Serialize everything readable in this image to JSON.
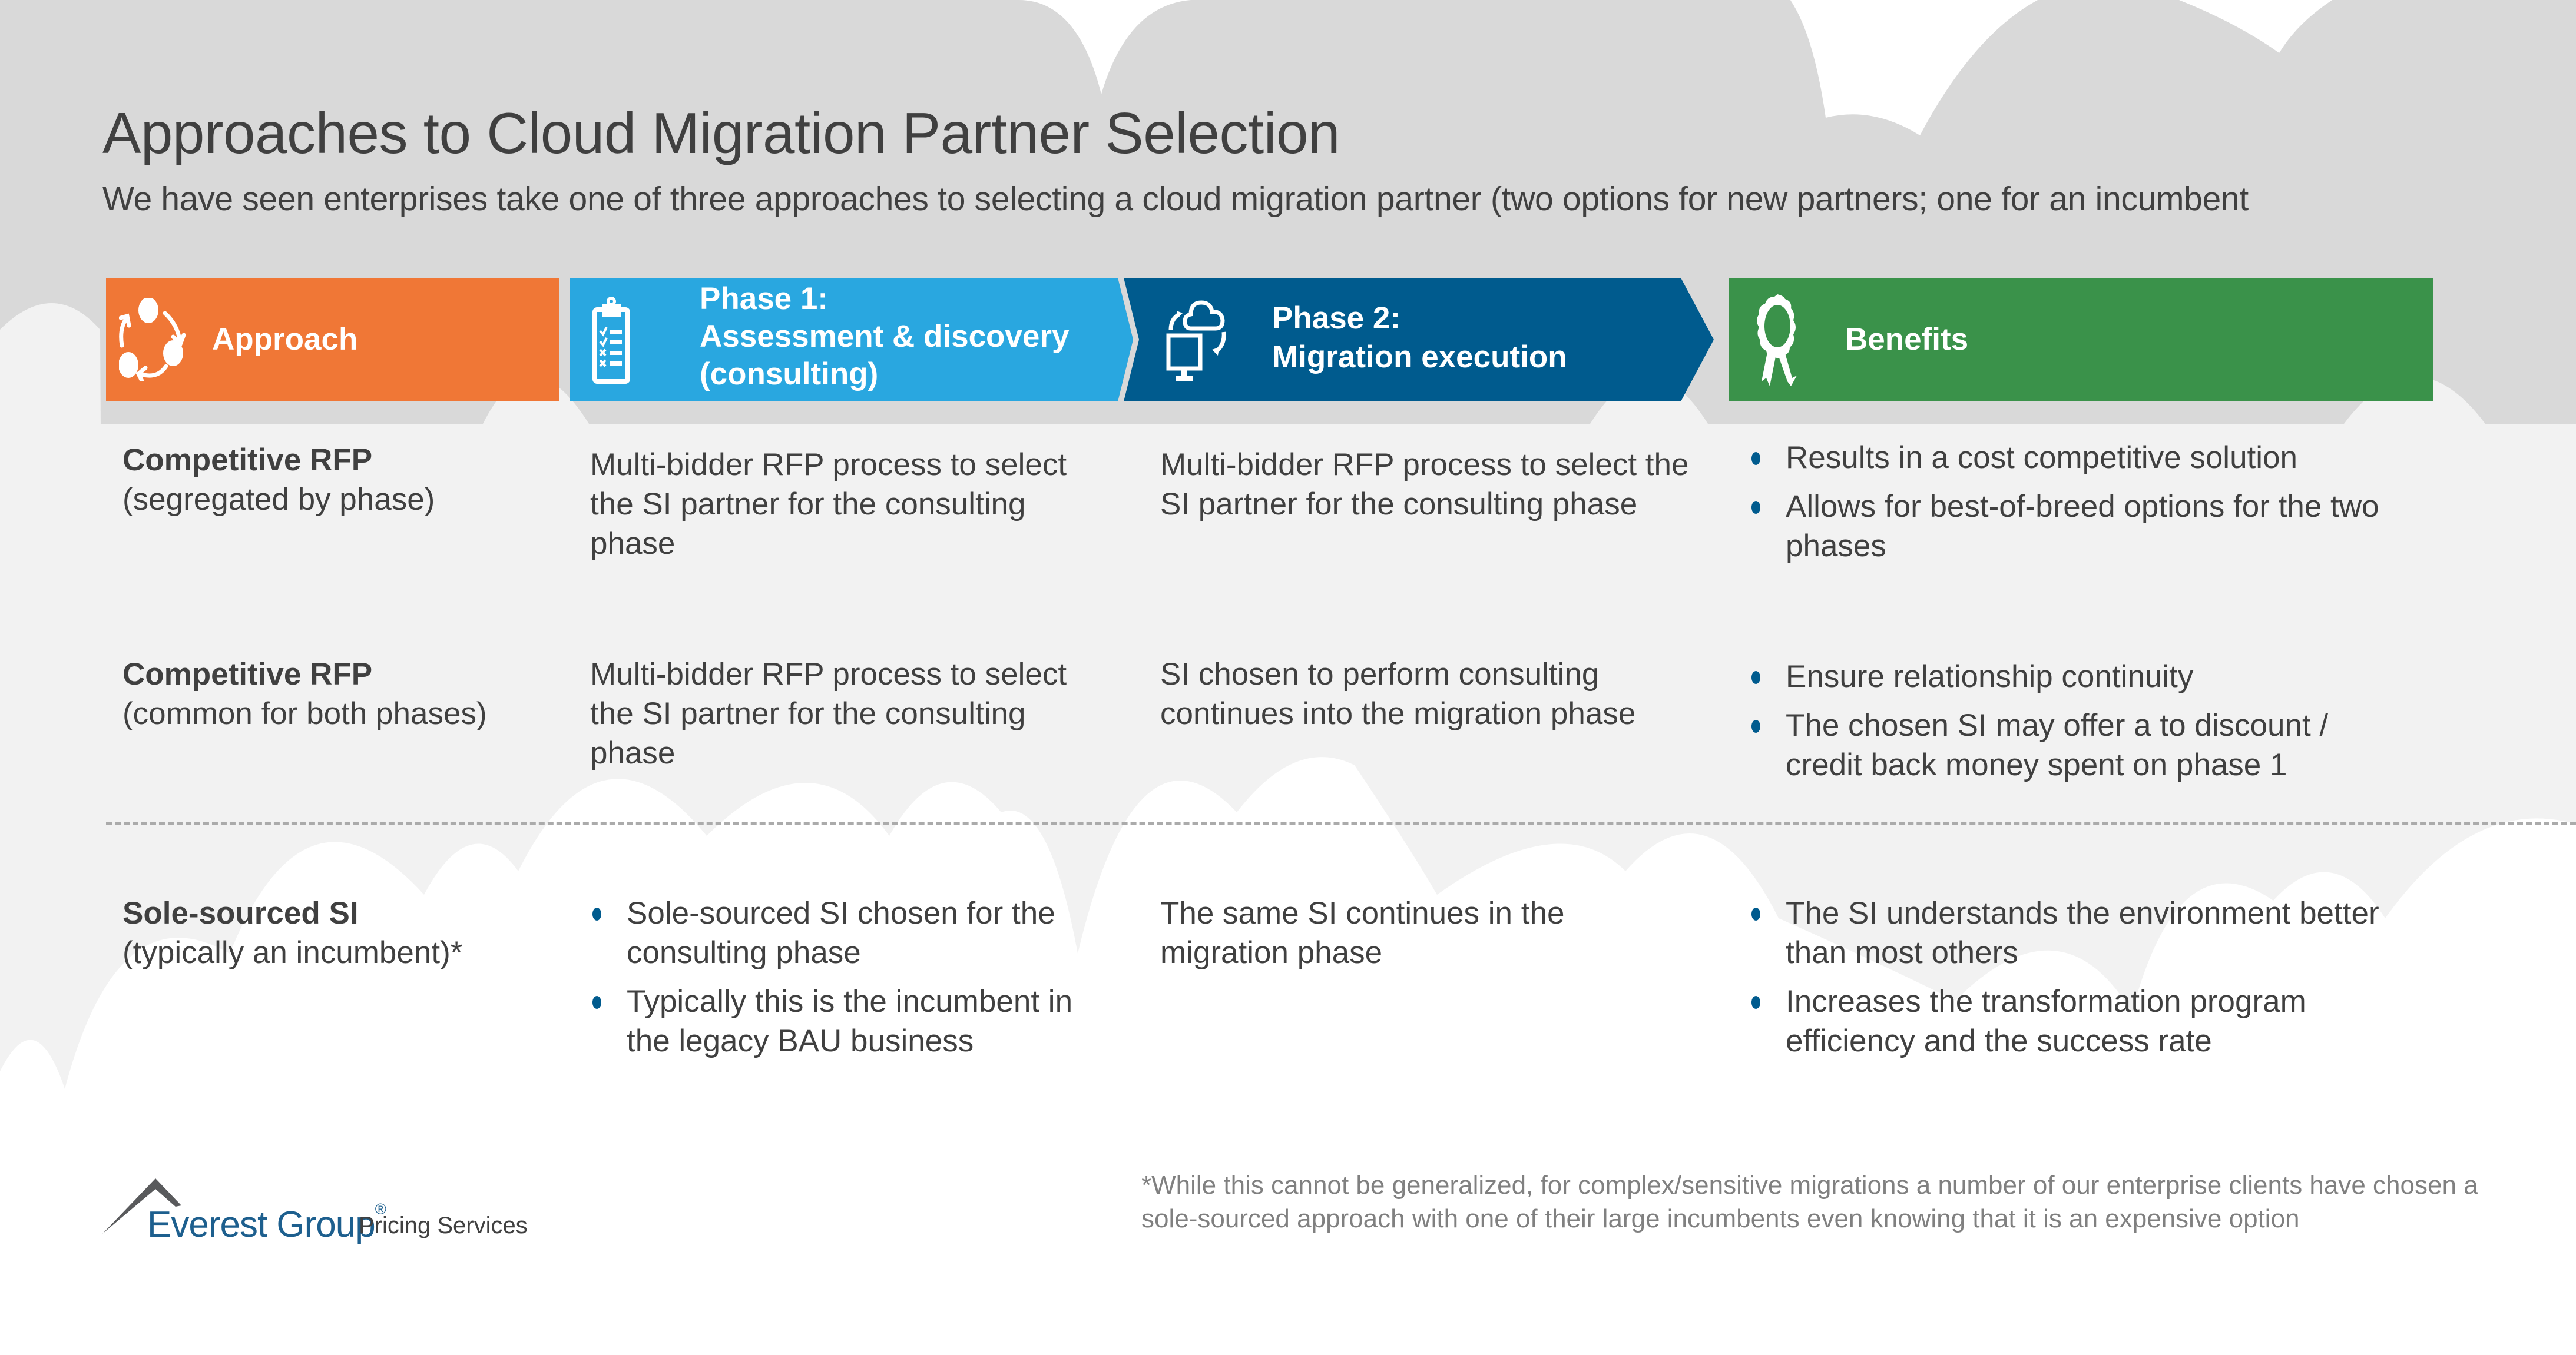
{
  "header": {
    "title": "Approaches to Cloud Migration Partner Selection",
    "subtitle": "We have seen enterprises take one of three approaches to selecting a cloud migration partner (two options for new partners; one for an incumbent"
  },
  "columns": {
    "approach": {
      "label": "Approach",
      "icon": "cycle-arrows-icon",
      "color": "#f07736"
    },
    "phase1": {
      "line1": "Phase 1:",
      "line2": "Assessment & discovery",
      "line3": "(consulting)",
      "icon": "clipboard-checklist-icon",
      "color": "#29a7e0"
    },
    "phase2": {
      "line1": "Phase 2:",
      "line2": "Migration execution",
      "icon": "cloud-monitor-sync-icon",
      "color": "#005b8e"
    },
    "benefits": {
      "label": "Benefits",
      "icon": "award-ribbon-icon",
      "color": "#3a924a"
    }
  },
  "rows": [
    {
      "approach_title": "Competitive RFP",
      "approach_sub": "(segregated by phase)",
      "phase1": "Multi-bidder RFP process to select the SI partner for the consulting phase",
      "phase2": "Multi-bidder RFP process to select the SI partner for the consulting phase",
      "benefits": [
        "Results in a cost competitive solution",
        "Allows for best-of-breed options for the two phases"
      ]
    },
    {
      "approach_title": "Competitive RFP",
      "approach_sub": "(common for both phases)",
      "phase1": "Multi-bidder RFP process to select the SI partner for the consulting phase",
      "phase2": "SI chosen to perform consulting continues into the migration phase",
      "benefits": [
        "Ensure relationship continuity",
        "The chosen SI may offer a to discount / credit back money spent on phase 1"
      ]
    },
    {
      "approach_title": "Sole-sourced SI",
      "approach_sub": "(typically an incumbent)*",
      "phase1_bullets": [
        "Sole-sourced SI chosen for the consulting phase",
        "Typically this is the incumbent in the legacy BAU business"
      ],
      "phase2": "The same SI continues in the migration phase",
      "benefits": [
        "The SI understands the environment better than most others",
        "Increases the transformation program efficiency and the success rate"
      ]
    }
  ],
  "footer": {
    "logo_name": "Everest Group",
    "logo_reg": "®",
    "logo_unit": "Pricing Services",
    "footnote": "*While this cannot be generalized, for complex/sensitive migrations a number of our enterprise clients have chosen a sole-sourced approach with one of their large incumbents even knowing that it is an expensive option"
  },
  "colors": {
    "bullet": "#005b8e",
    "cloud_dark": "#d9d9d9",
    "cloud_light": "#f2f2f2"
  }
}
